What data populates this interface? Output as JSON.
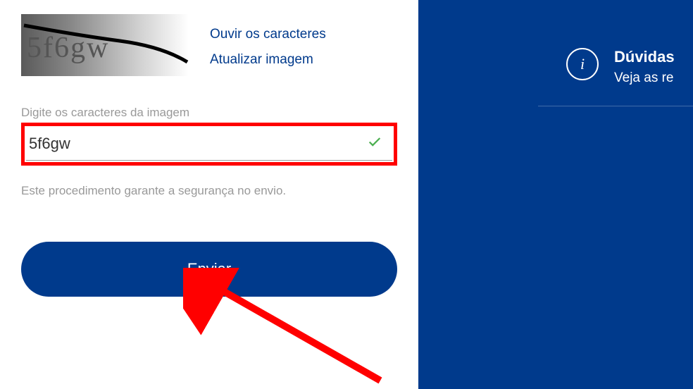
{
  "captcha": {
    "image_text": "5f6gw",
    "listen_label": "Ouvir os caracteres",
    "refresh_label": "Atualizar imagem",
    "input_label": "Digite os caracteres da imagem",
    "input_value": "5f6gw",
    "help_text": "Este procedimento garante a segurança no envio.",
    "submit_label": "Enviar"
  },
  "sidebar": {
    "info_title": "Dúvidas",
    "info_subtitle": "Veja as re",
    "info_glyph": "i"
  }
}
